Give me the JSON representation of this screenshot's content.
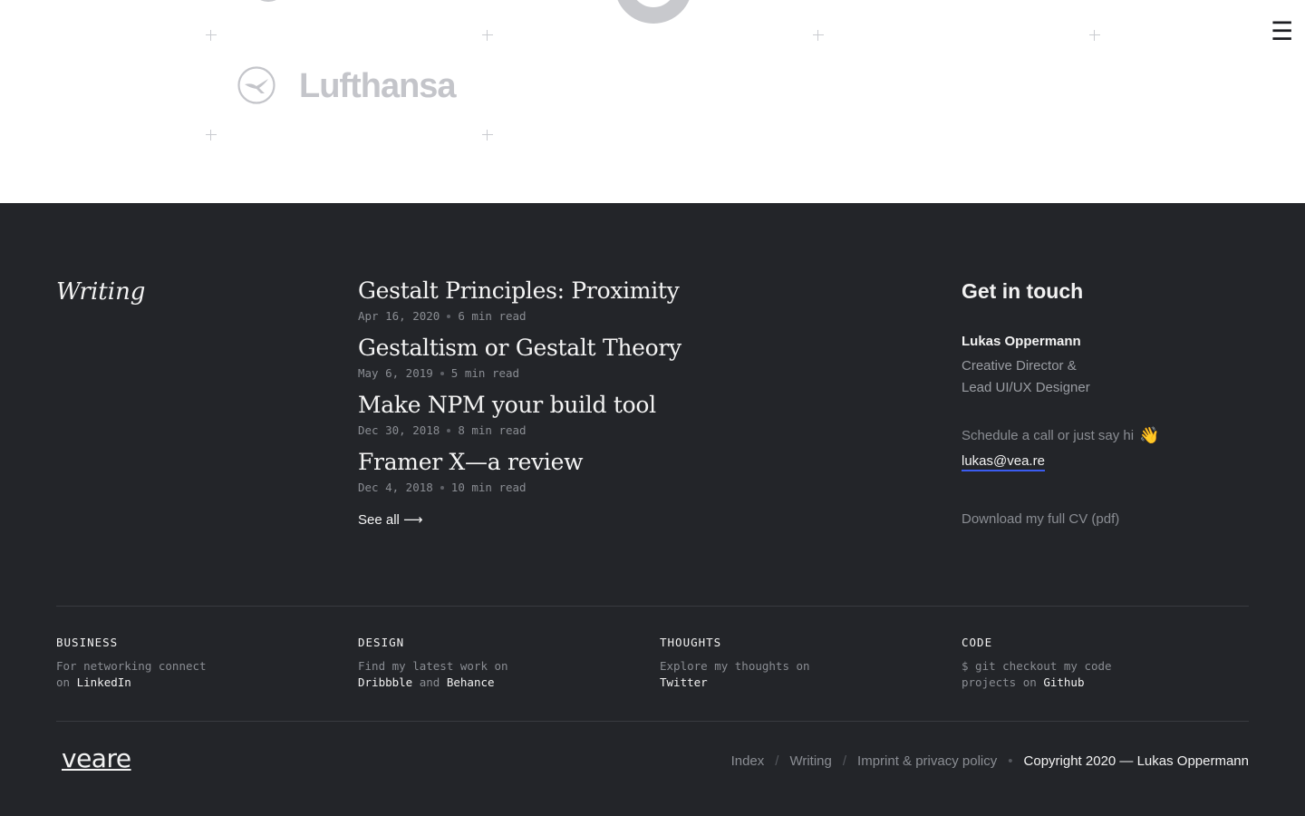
{
  "nav": {
    "menu_icon": "☰"
  },
  "clients": {
    "lufthansa_label": "Lufthansa"
  },
  "writing": {
    "heading": "Writing",
    "articles": [
      {
        "title": "Gestalt Principles: Proximity",
        "date": "Apr 16, 2020",
        "read": "6 min read"
      },
      {
        "title": "Gestaltism or Gestalt Theory",
        "date": "May 6, 2019",
        "read": "5 min read"
      },
      {
        "title": "Make NPM your build tool",
        "date": "Dec 30, 2018",
        "read": "8 min read"
      },
      {
        "title": "Framer X—a review",
        "date": "Dec 4, 2018",
        "read": "10 min read"
      }
    ],
    "see_all": "See all ⟶"
  },
  "contact": {
    "heading": "Get in touch",
    "name": "Lukas Oppermann",
    "role_line1": "Creative Director &",
    "role_line2": "Lead UI/UX Designer",
    "hi_text": "Schedule a call or just say hi",
    "wave_emoji": "👋",
    "email": "lukas@vea.re",
    "cv_link": "Download my full CV (pdf)"
  },
  "columns": {
    "business": {
      "head": "BUSINESS",
      "text1": "For networking connect",
      "text2": "on",
      "link": "LinkedIn"
    },
    "design": {
      "head": "DESIGN",
      "text1": "Find my latest work on",
      "link1": "Dribbble",
      "and": "and",
      "link2": "Behance"
    },
    "thoughts": {
      "head": "THOUGHTS",
      "text1": "Explore my thoughts on",
      "link": "Twitter"
    },
    "code": {
      "head": "CODE",
      "text1": "$ git checkout my code",
      "text2": "projects on",
      "link": "Github"
    }
  },
  "footer": {
    "brand": "veare",
    "links": [
      "Index",
      "Writing",
      "Imprint & privacy policy"
    ],
    "slash": "/",
    "bullet": "•",
    "copyright": "Copyright 2020 — Lukas Oppermann"
  },
  "colors": {
    "accent_underline": "#3b5cf0",
    "dark_bg": "#232529",
    "logo_gray": "#c4c5ca"
  }
}
